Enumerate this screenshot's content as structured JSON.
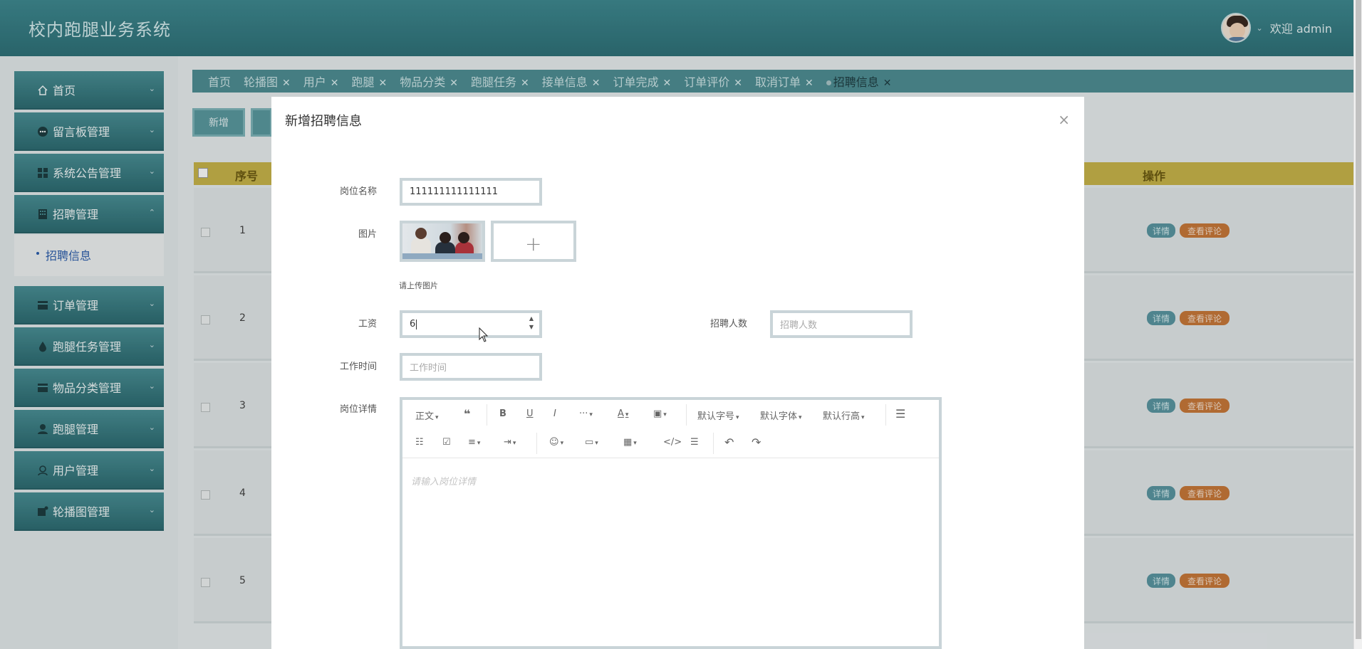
{
  "app": {
    "title": "校内跑腿业务系统"
  },
  "user": {
    "greeting": "欢迎 admin"
  },
  "sidebar": {
    "items": [
      {
        "label": "首页",
        "icon": "home-icon"
      },
      {
        "label": "留言板管理",
        "icon": "chat-icon"
      },
      {
        "label": "系统公告管理",
        "icon": "grid-icon"
      },
      {
        "label": "招聘管理",
        "icon": "building-icon"
      },
      {
        "label": "订单管理",
        "icon": "card-icon"
      },
      {
        "label": "跑腿任务管理",
        "icon": "drop-icon"
      },
      {
        "label": "物品分类管理",
        "icon": "card-icon"
      },
      {
        "label": "跑腿管理",
        "icon": "person-icon"
      },
      {
        "label": "用户管理",
        "icon": "user-outline-icon"
      },
      {
        "label": "轮播图管理",
        "icon": "image-icon"
      }
    ],
    "submenu": {
      "label": "招聘信息"
    }
  },
  "tabs": [
    {
      "label": "首页"
    },
    {
      "label": "轮播图"
    },
    {
      "label": "用户"
    },
    {
      "label": "跑腿"
    },
    {
      "label": "物品分类"
    },
    {
      "label": "跑腿任务"
    },
    {
      "label": "接单信息"
    },
    {
      "label": "订单完成"
    },
    {
      "label": "订单评价"
    },
    {
      "label": "取消订单"
    },
    {
      "label": "招聘信息",
      "active": true
    }
  ],
  "toolbar": {
    "add_label": "新增"
  },
  "table": {
    "headers": {
      "no": "序号",
      "ops": "操作"
    },
    "rows": [
      {
        "no": "1"
      },
      {
        "no": "2"
      },
      {
        "no": "3"
      },
      {
        "no": "4"
      },
      {
        "no": "5"
      }
    ],
    "detail_label": "详情",
    "comments_label": "查看评论"
  },
  "modal": {
    "title": "新增招聘信息",
    "close": "×",
    "fields": {
      "position_name": {
        "label": "岗位名称",
        "value": "111111111111111"
      },
      "image": {
        "label": "图片",
        "hint": "请上传图片",
        "upload_symbol": "+"
      },
      "salary": {
        "label": "工资",
        "value": "6"
      },
      "headcount": {
        "label": "招聘人数",
        "placeholder": "招聘人数"
      },
      "work_time": {
        "label": "工作时间",
        "placeholder": "工作时间"
      },
      "details": {
        "label": "岗位详情",
        "placeholder": "请输入岗位详情"
      }
    },
    "editor_toolbar": {
      "paragraph": "正文",
      "font_size": "默认字号",
      "font_family": "默认字体",
      "line_height": "默认行高"
    }
  },
  "colors": {
    "header": "#357a80",
    "tab_bar": "#4f8f95",
    "table_head": "#c9b64a",
    "detail_badge": "#5b97a2",
    "comment_badge": "#c9793a"
  }
}
